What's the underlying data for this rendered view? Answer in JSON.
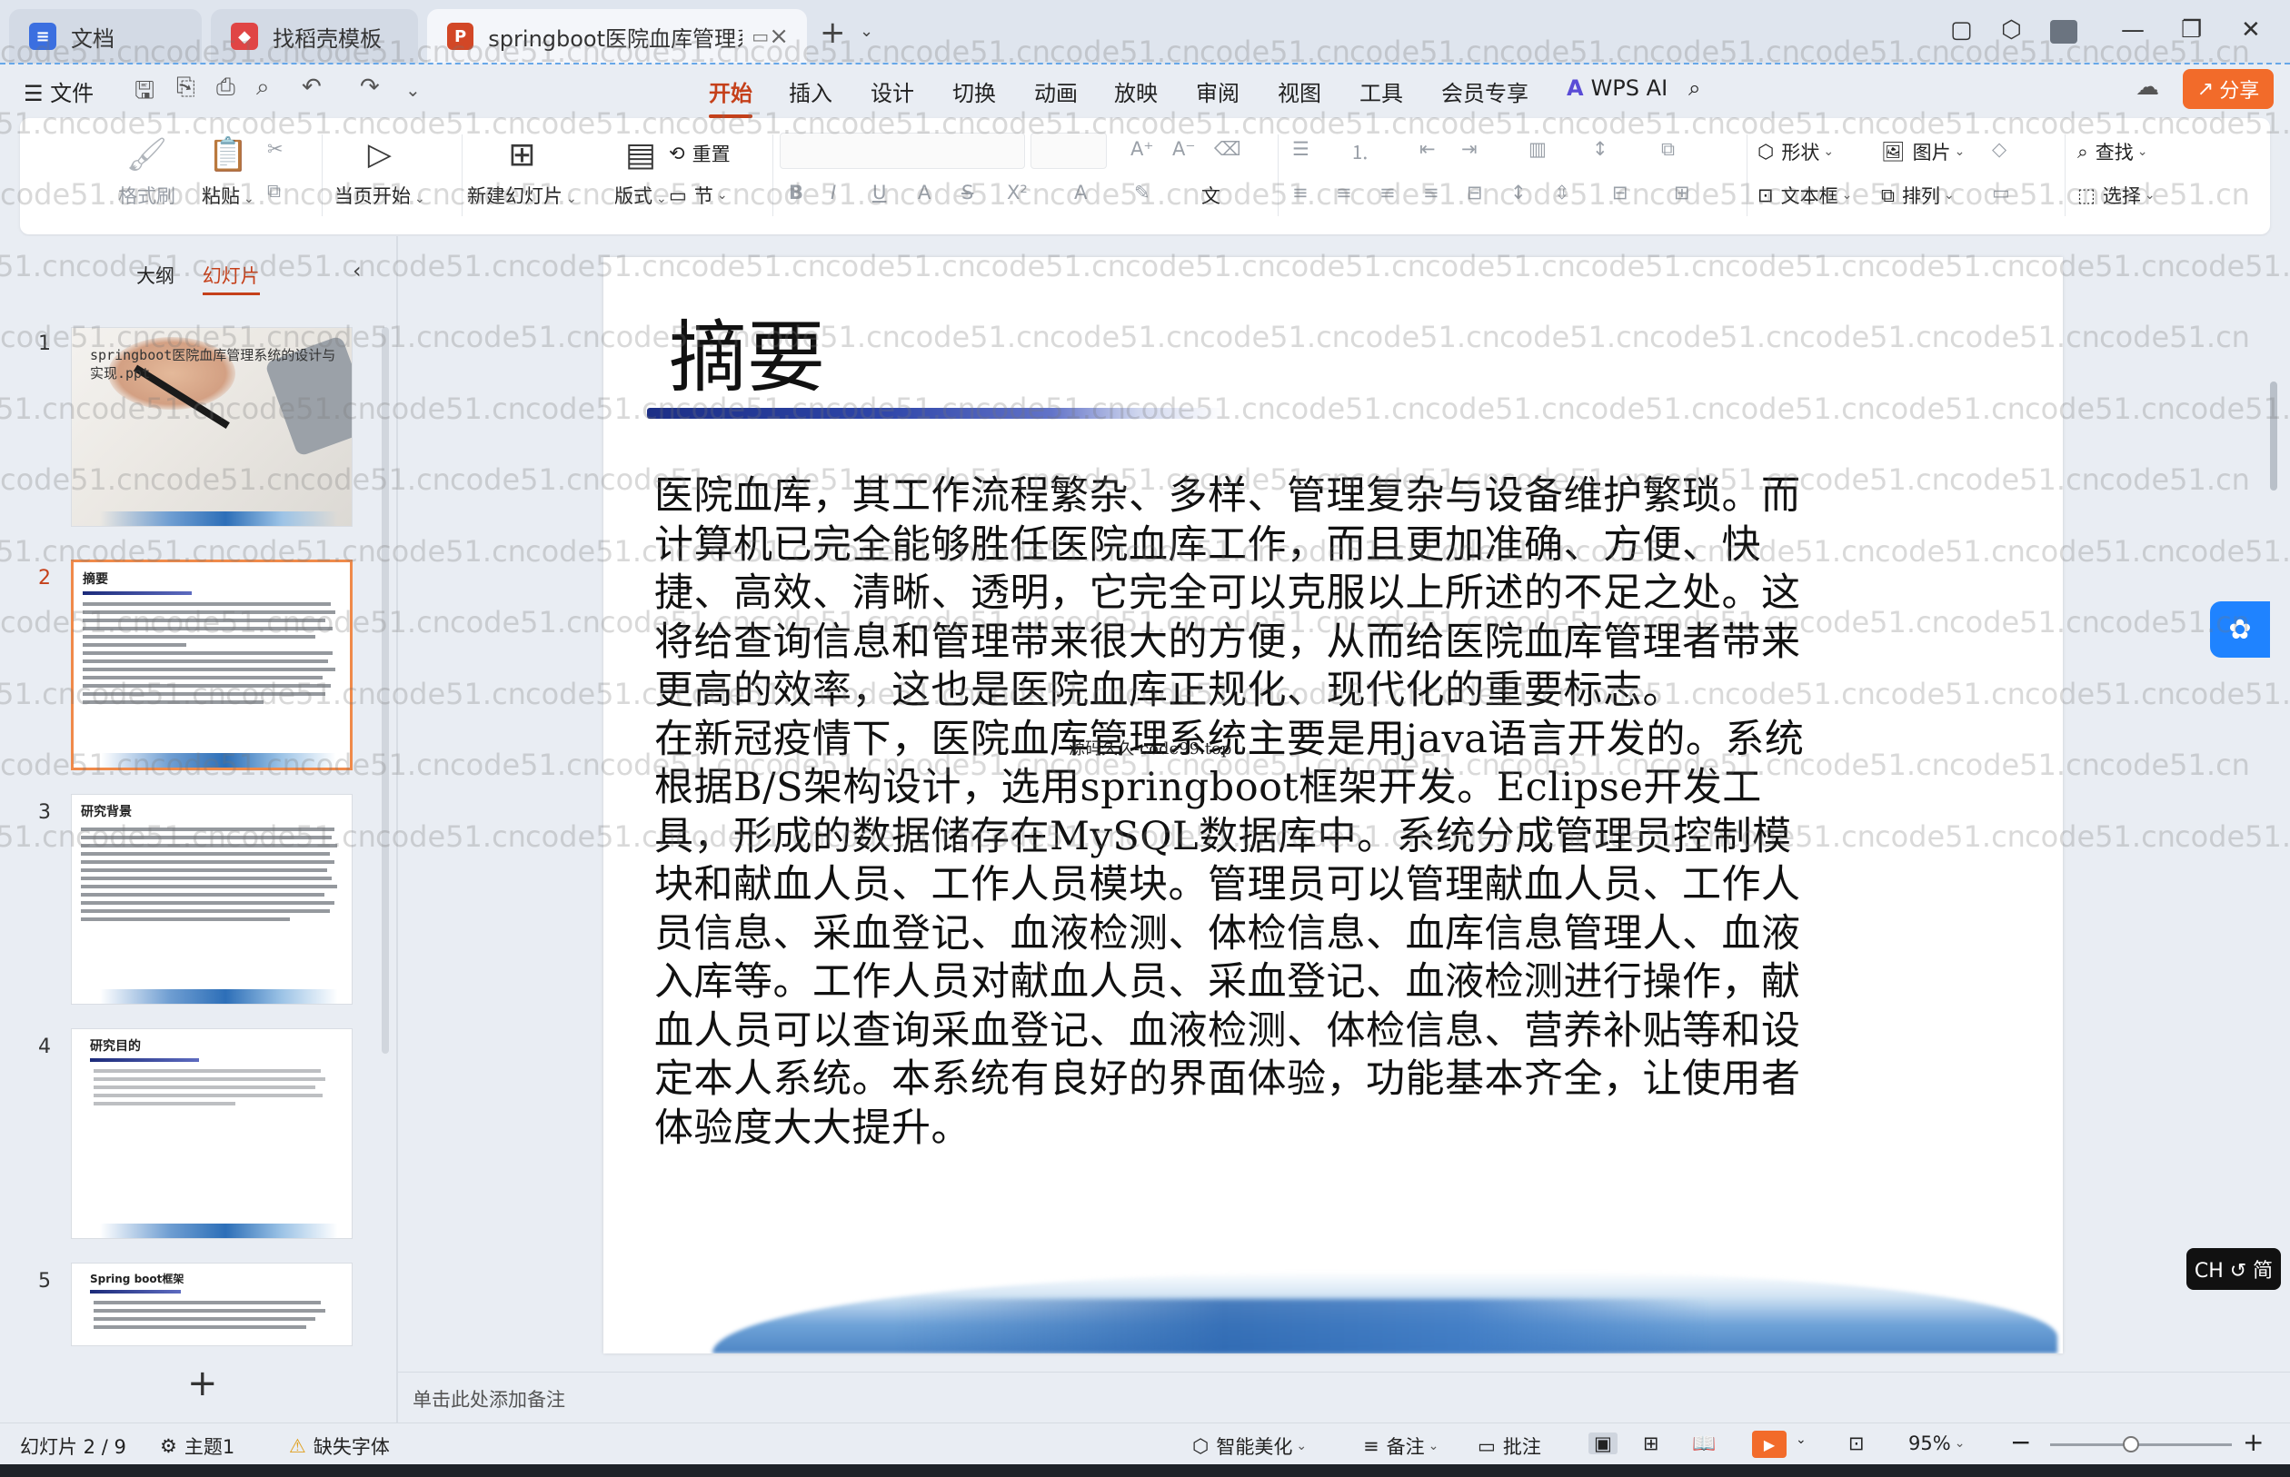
{
  "tabs": [
    {
      "label": "文档",
      "icon": "document-icon",
      "color": "#3b6fe0"
    },
    {
      "label": "找稻壳模板",
      "icon": "docer-icon",
      "color": "#e04545"
    },
    {
      "label": "springboot医院血库管理系统",
      "icon": "ppt-icon",
      "color": "#d24726"
    }
  ],
  "menu": {
    "file": "文件",
    "tabs": [
      "开始",
      "插入",
      "设计",
      "切换",
      "动画",
      "放映",
      "审阅",
      "视图",
      "工具",
      "会员专享"
    ],
    "active_tab": "开始",
    "wps_ai": "WPS AI",
    "share": "分享",
    "accent_color": "#c5401a"
  },
  "ribbon": {
    "format_painter": "格式刷",
    "paste": "粘贴",
    "from_current": "当页开始",
    "new_slide": "新建幻灯片",
    "layout": "版式",
    "reset": "重置",
    "section": "节",
    "shape": "形状",
    "picture": "图片",
    "textbox": "文本框",
    "arrange": "排列",
    "find": "查找",
    "select": "选择"
  },
  "left_pane": {
    "outline_tab": "大纲",
    "slides_tab": "幻灯片",
    "slides": [
      {
        "num": "1",
        "title": "springboot医院血库管理系统的设计与实现.ppt"
      },
      {
        "num": "2",
        "title": "摘要"
      },
      {
        "num": "3",
        "title": "研究背景"
      },
      {
        "num": "4",
        "title": "研究目的"
      },
      {
        "num": "5",
        "title": "Spring boot框架"
      }
    ],
    "selected": "2"
  },
  "slide": {
    "title": "摘要",
    "paragraphs": [
      "医院血库，其工作流程繁杂、多样、管理复杂与设备维护繁琐。而计算机已完全能够胜任医院血库工作，而且更加准确、方便、快捷、高效、清晰、透明，它完全可以克服以上所述的不足之处。这将给查询信息和管理带来很大的方便，从而给医院血库管理者带来更高的效率，这也是医院血库正规化、现代化的重要标志。",
      "在新冠疫情下，医院血库管理系统主要是用java语言开发的。系统根据B/S架构设计，选用springboot框架开发。Eclipse开发工具，形成的数据储存在MySQL数据库中。系统分成管理员控制模块和献血人员、工作人员模块。管理员可以管理献血人员、工作人员信息、采血登记、血液检测、体检信息、血库信息管理人、血液入库等。工作人员对献血人员、采血登记、血液检测进行操作，献血人员可以查询采血登记、血液检测、体检信息、营养补贴等和设定本人系统。本系统有良好的界面体验，功能基本齐全，让使用者体验度大大提升。"
    ],
    "source_note": "源码久久-code99.top"
  },
  "notes_placeholder": "单击此处添加备注",
  "status": {
    "slide_counter": "幻灯片 2 / 9",
    "theme": "主题1",
    "missing_font": "缺失字体",
    "smart_beautify": "智能美化",
    "notes": "备注",
    "comments": "批注",
    "zoom": "95%",
    "zoom_level": 0.95
  },
  "ime": "CH ↺ 简",
  "watermark": "code51.cn"
}
